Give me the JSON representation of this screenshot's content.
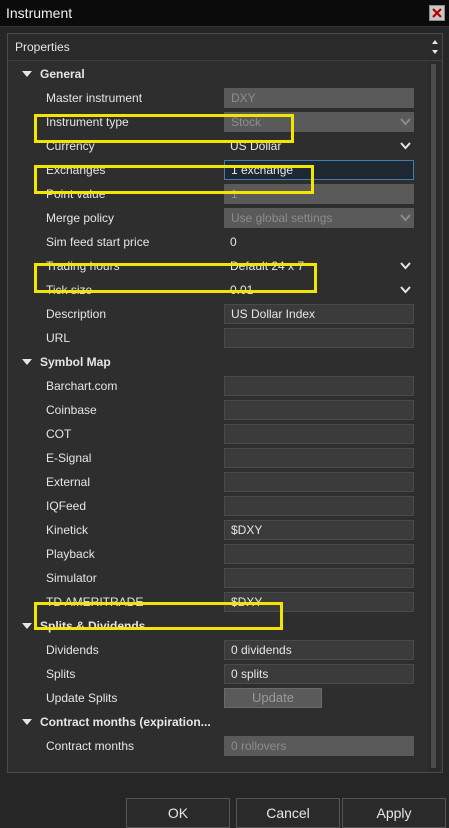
{
  "window": {
    "title": "Instrument"
  },
  "panel": {
    "header": "Properties"
  },
  "rows": [
    {
      "kind": "section",
      "label": "General"
    },
    {
      "kind": "prop",
      "label": "Master instrument",
      "value": "DXY",
      "style": "disabled"
    },
    {
      "kind": "prop",
      "label": "Instrument type",
      "value": "Stock",
      "style": "disabled",
      "dropdown": true
    },
    {
      "kind": "prop",
      "label": "Currency",
      "value": "US Dollar",
      "style": "plain",
      "dropdown": true
    },
    {
      "kind": "prop",
      "label": "Exchanges",
      "value": "1 exchange",
      "style": "editing"
    },
    {
      "kind": "prop",
      "label": "Point value",
      "value": "1",
      "style": "disabled"
    },
    {
      "kind": "prop",
      "label": "Merge policy",
      "value": "Use global settings",
      "style": "disabled",
      "dropdown": true
    },
    {
      "kind": "prop",
      "label": "Sim feed start price",
      "value": "0",
      "style": "plain"
    },
    {
      "kind": "prop",
      "label": "Trading hours",
      "value": "Default 24 x 7",
      "style": "plain",
      "dropdown": true
    },
    {
      "kind": "prop",
      "label": "Tick size",
      "value": "0.01",
      "style": "plain",
      "dropdown": true
    },
    {
      "kind": "prop",
      "label": "Description",
      "value": "US Dollar Index",
      "style": "box"
    },
    {
      "kind": "prop",
      "label": "URL",
      "value": "",
      "style": "box"
    },
    {
      "kind": "section",
      "label": "Symbol Map"
    },
    {
      "kind": "prop",
      "label": "Barchart.com",
      "value": "",
      "style": "box"
    },
    {
      "kind": "prop",
      "label": "Coinbase",
      "value": "",
      "style": "box"
    },
    {
      "kind": "prop",
      "label": "COT",
      "value": "",
      "style": "box"
    },
    {
      "kind": "prop",
      "label": "E-Signal",
      "value": "",
      "style": "box"
    },
    {
      "kind": "prop",
      "label": "External",
      "value": "",
      "style": "box"
    },
    {
      "kind": "prop",
      "label": "IQFeed",
      "value": "",
      "style": "box"
    },
    {
      "kind": "prop",
      "label": "Kinetick",
      "value": "$DXY",
      "style": "box"
    },
    {
      "kind": "prop",
      "label": "Playback",
      "value": "",
      "style": "box"
    },
    {
      "kind": "prop",
      "label": "Simulator",
      "value": "",
      "style": "box"
    },
    {
      "kind": "prop",
      "label": "TD AMERITRADE",
      "value": "$DXY",
      "style": "box"
    },
    {
      "kind": "section",
      "label": "Splits & Dividends"
    },
    {
      "kind": "prop",
      "label": "Dividends",
      "value": "0 dividends",
      "style": "box"
    },
    {
      "kind": "prop",
      "label": "Splits",
      "value": "0 splits",
      "style": "box"
    },
    {
      "kind": "prop",
      "label": "Update Splits",
      "value": "Update",
      "style": "button"
    },
    {
      "kind": "section",
      "label": "Contract months (expiration..."
    },
    {
      "kind": "prop",
      "label": "Contract months",
      "value": "0 rollovers",
      "style": "disabled"
    }
  ],
  "buttons": {
    "ok": "OK",
    "cancel": "Cancel",
    "apply": "Apply"
  },
  "colors": {
    "highlight": "#f2e600",
    "background": "#262626",
    "edit_border": "#3c7fb1"
  }
}
